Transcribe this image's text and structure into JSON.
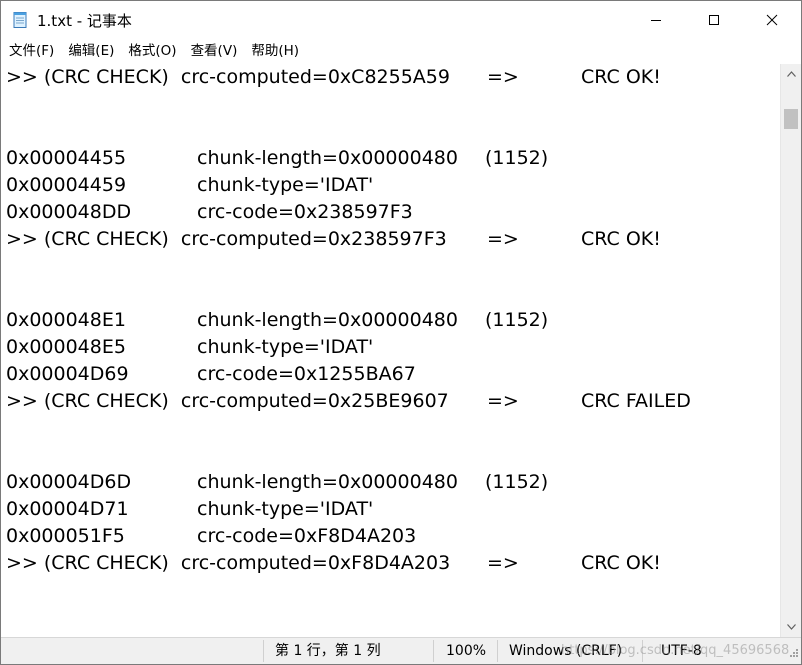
{
  "window": {
    "title": "1.txt - 记事本",
    "icon": "notepad-icon"
  },
  "menu": [
    {
      "label": "文件(F)"
    },
    {
      "label": "编辑(E)"
    },
    {
      "label": "格式(O)"
    },
    {
      "label": "查看(V)"
    },
    {
      "label": "帮助(H)"
    }
  ],
  "lines": [
    {
      "c1": ">> (CRC CHECK)  crc-computed=0xC8255A59",
      "c2": "=>",
      "c3": "CRC OK!"
    },
    {},
    {},
    {
      "c1": "0x00004455",
      "c4": "chunk-length=0x00000480",
      "c5": "(1152)"
    },
    {
      "c1": "0x00004459",
      "c4": "chunk-type='IDAT'"
    },
    {
      "c1": "0x000048DD",
      "c4": "crc-code=0x238597F3"
    },
    {
      "c1": ">> (CRC CHECK)  crc-computed=0x238597F3",
      "c2": "=>",
      "c3": "CRC OK!"
    },
    {},
    {},
    {
      "c1": "0x000048E1",
      "c4": "chunk-length=0x00000480",
      "c5": "(1152)"
    },
    {
      "c1": "0x000048E5",
      "c4": "chunk-type='IDAT'"
    },
    {
      "c1": "0x00004D69",
      "c4": "crc-code=0x1255BA67"
    },
    {
      "c1": ">> (CRC CHECK)  crc-computed=0x25BE9607",
      "c2": "=>",
      "c3": "CRC FAILED"
    },
    {},
    {},
    {
      "c1": "0x00004D6D",
      "c4": "chunk-length=0x00000480",
      "c5": "(1152)"
    },
    {
      "c1": "0x00004D71",
      "c4": "chunk-type='IDAT'"
    },
    {
      "c1": "0x000051F5",
      "c4": "crc-code=0xF8D4A203"
    },
    {
      "c1": ">> (CRC CHECK)  crc-computed=0xF8D4A203",
      "c2": "=>",
      "c3": "CRC OK!"
    }
  ],
  "status": {
    "position": "第 1 行，第 1 列",
    "zoom": "100%",
    "line_ending": "Windows (CRLF)",
    "encoding": "UTF-8",
    "watermark": "https://blog.csdn.net/qq_45696568"
  }
}
